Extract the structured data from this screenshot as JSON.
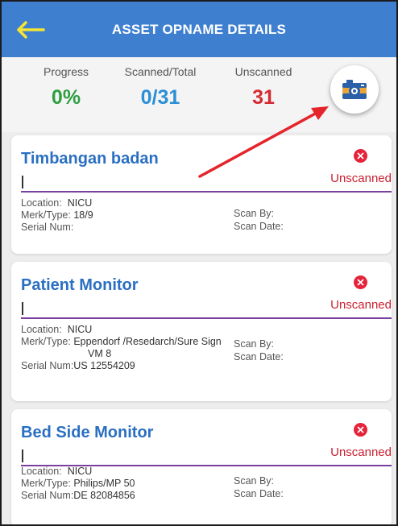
{
  "header": {
    "title": "ASSET OPNAME DETAILS",
    "back_icon": "arrow-left-icon"
  },
  "stats": {
    "progress": {
      "label": "Progress",
      "value": "0%",
      "color": "#2f9e41"
    },
    "scanned": {
      "label": "Scanned/Total",
      "value": "0/31",
      "color": "#2b8fd6"
    },
    "unscanned": {
      "label": "Unscanned",
      "value": "31",
      "color": "#d42a33"
    }
  },
  "camera_icon": "camera-icon",
  "labels": {
    "location": "Location:",
    "merk": "Merk/Type:",
    "serial": "Serial Num:",
    "scan_by": "Scan By:",
    "scan_date": "Scan Date:"
  },
  "assets": [
    {
      "name": "Timbangan badan",
      "status": "Unscanned",
      "location": "NICU",
      "merk": "18/9",
      "serial": ""
    },
    {
      "name": "Patient Monitor",
      "status": "Unscanned",
      "location": "NICU",
      "merk_line1": "Eppendorf /Resedarch/Sure Sign",
      "merk_line2": "VM 8",
      "serial": "US 12554209"
    },
    {
      "name": "Bed Side Monitor",
      "status": "Unscanned",
      "location": "NICU",
      "merk": "Philips/MP 50",
      "serial": "DE 82084856"
    }
  ],
  "accent_colors": {
    "header": "#3e7fd0",
    "title": "#2a6fc2",
    "status": "#c91f2f",
    "annotation": "#e5242b"
  }
}
